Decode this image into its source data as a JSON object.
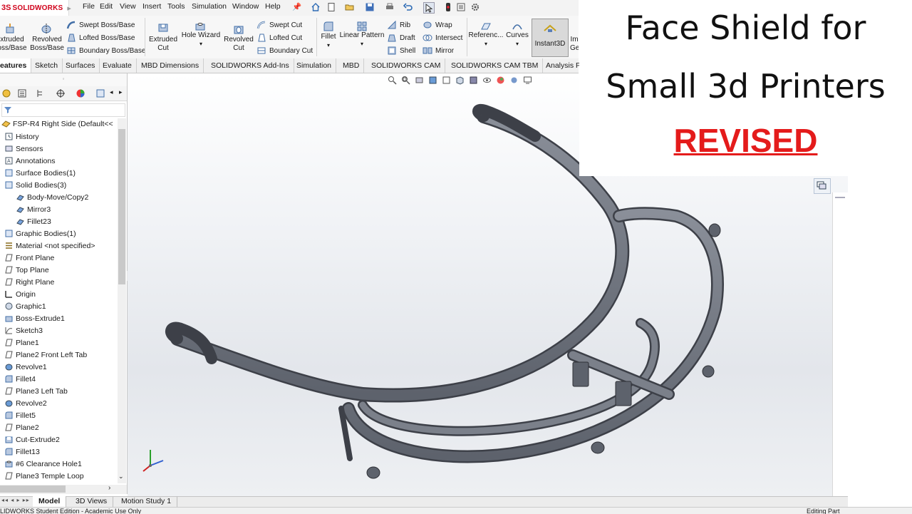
{
  "app": {
    "logo_prefix": "3S",
    "logo_name": "SOLIDWORKS"
  },
  "menu": [
    "File",
    "Edit",
    "View",
    "Insert",
    "Tools",
    "Simulation",
    "Window",
    "Help"
  ],
  "features": {
    "extruded_boss": [
      "xtruded",
      "oss/Base"
    ],
    "revolved_boss": [
      "Revolved",
      "Boss/Base"
    ],
    "swept_boss": "Swept Boss/Base",
    "lofted_boss": "Lofted Boss/Base",
    "boundary_boss": "Boundary Boss/Base",
    "extruded_cut": [
      "Extruded",
      "Cut"
    ],
    "hole_wizard": "Hole Wizard",
    "revolved_cut": [
      "Revolved",
      "Cut"
    ],
    "swept_cut": "Swept Cut",
    "lofted_cut": "Lofted Cut",
    "boundary_cut": "Boundary Cut",
    "fillet": "Fillet",
    "linear_pattern": "Linear Pattern",
    "rib": "Rib",
    "draft": "Draft",
    "shell": "Shell",
    "wrap": "Wrap",
    "intersect": "Intersect",
    "mirror": "Mirror",
    "reference": "Referenc...",
    "curves": "Curves",
    "instant3d": "Instant3D",
    "truncated_top": "Im",
    "truncated_bottom": "Ge"
  },
  "tabs": [
    "eatures",
    "Sketch",
    "Surfaces",
    "Evaluate",
    "MBD Dimensions",
    "SOLIDWORKS Add-Ins",
    "Simulation",
    "MBD",
    "SOLIDWORKS CAM",
    "SOLIDWORKS CAM TBM",
    "Analysis P"
  ],
  "tree": {
    "root": "FSP-R4 Right Side  (Default<<",
    "items": [
      {
        "label": "History",
        "icon": "history-icon"
      },
      {
        "label": "Sensors",
        "icon": "sensors-icon"
      },
      {
        "label": "Annotations",
        "icon": "annotations-icon"
      },
      {
        "label": "Surface Bodies(1)",
        "icon": "folder-icon"
      },
      {
        "label": "Solid Bodies(3)",
        "icon": "folder-icon"
      },
      {
        "label": "Body-Move/Copy2",
        "icon": "body-icon",
        "indent": true
      },
      {
        "label": "Mirror3",
        "icon": "body-icon",
        "indent": true
      },
      {
        "label": "Fillet23",
        "icon": "body-icon",
        "indent": true
      },
      {
        "label": "Graphic Bodies(1)",
        "icon": "folder-icon"
      },
      {
        "label": "Material <not specified>",
        "icon": "material-icon"
      },
      {
        "label": "Front Plane",
        "icon": "plane-icon"
      },
      {
        "label": "Top Plane",
        "icon": "plane-icon"
      },
      {
        "label": "Right Plane",
        "icon": "plane-icon"
      },
      {
        "label": "Origin",
        "icon": "origin-icon"
      },
      {
        "label": "Graphic1",
        "icon": "graphic-icon"
      },
      {
        "label": "Boss-Extrude1",
        "icon": "extrude-icon"
      },
      {
        "label": "Sketch3",
        "icon": "sketch-icon"
      },
      {
        "label": "Plane1",
        "icon": "plane-icon"
      },
      {
        "label": "Plane2 Front Left Tab",
        "icon": "plane-icon"
      },
      {
        "label": "Revolve1",
        "icon": "revolve-icon"
      },
      {
        "label": "Fillet4",
        "icon": "fillet-icon"
      },
      {
        "label": "Plane3 Left Tab",
        "icon": "plane-icon"
      },
      {
        "label": "Revolve2",
        "icon": "revolve-icon"
      },
      {
        "label": "Fillet5",
        "icon": "fillet-icon"
      },
      {
        "label": "Plane2",
        "icon": "plane-icon"
      },
      {
        "label": "Cut-Extrude2",
        "icon": "cut-icon"
      },
      {
        "label": "Fillet13",
        "icon": "fillet-icon"
      },
      {
        "label": "#6 Clearance Hole1",
        "icon": "hole-icon"
      },
      {
        "label": "Plane3 Temple Loop",
        "icon": "plane-icon"
      }
    ]
  },
  "bottom_tabs": [
    "Model",
    "3D Views",
    "Motion Study 1"
  ],
  "status": {
    "left": "LIDWORKS Student Edition - Academic Use Only",
    "right": "Editing Part"
  },
  "overlay": {
    "line1": "Face Shield for",
    "line2": "Small 3d Printers",
    "line3": "REVISED"
  },
  "colors": {
    "accent": "#d0021b",
    "revised": "#e41b1b",
    "part": "#6f7480"
  }
}
